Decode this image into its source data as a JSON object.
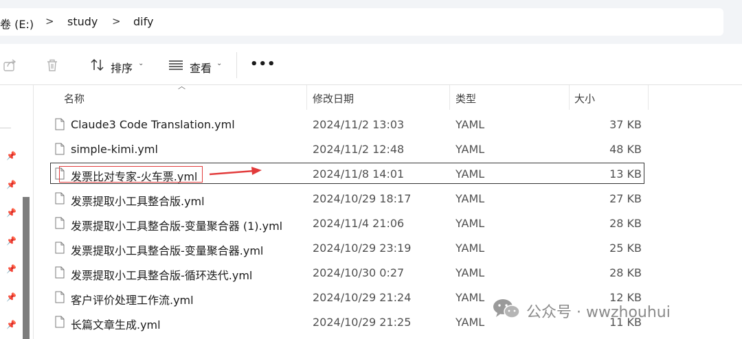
{
  "address": {
    "crumbs": [
      "卷 (E:)",
      "study",
      "dify"
    ],
    "separator": ">"
  },
  "toolbar": {
    "share_icon": "share-icon",
    "delete_icon": "trash-icon",
    "sort_label": "排序",
    "view_label": "查看",
    "more_label": "•••"
  },
  "columns": {
    "name": "名称",
    "modified": "修改日期",
    "type": "类型",
    "size": "大小"
  },
  "files": [
    {
      "name": "Claude3 Code Translation.yml",
      "modified": "2024/11/2 13:03",
      "type": "YAML",
      "size": "37 KB"
    },
    {
      "name": "simple-kimi.yml",
      "modified": "2024/11/2 12:48",
      "type": "YAML",
      "size": "48 KB"
    },
    {
      "name": "发票比对专家-火车票.yml",
      "modified": "2024/11/8 14:01",
      "type": "YAML",
      "size": "13 KB"
    },
    {
      "name": "发票提取小工具整合版.yml",
      "modified": "2024/10/29 18:17",
      "type": "YAML",
      "size": "27 KB"
    },
    {
      "name": "发票提取小工具整合版-变量聚合器 (1).yml",
      "modified": "2024/11/4 21:06",
      "type": "YAML",
      "size": "28 KB"
    },
    {
      "name": "发票提取小工具整合版-变量聚合器.yml",
      "modified": "2024/10/29 23:19",
      "type": "YAML",
      "size": "25 KB"
    },
    {
      "name": "发票提取小工具整合版-循环迭代.yml",
      "modified": "2024/10/30 0:27",
      "type": "YAML",
      "size": "28 KB"
    },
    {
      "name": "客户评价处理工作流.yml",
      "modified": "2024/10/29 21:24",
      "type": "YAML",
      "size": "12 KB"
    },
    {
      "name": "长篇文章生成.yml",
      "modified": "2024/10/29 21:25",
      "type": "YAML",
      "size": "11 KB"
    }
  ],
  "selected_index": 2,
  "annotation_color": "#e23b3b",
  "watermark": {
    "icon": "wechat-icon",
    "text": "公众号 · wwzhouhui"
  }
}
